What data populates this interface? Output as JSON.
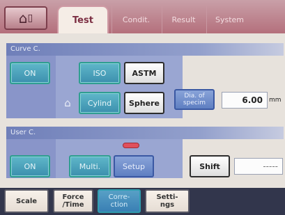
{
  "tabs": [
    {
      "label": "Test",
      "active": true
    },
    {
      "label": "Condit."
    },
    {
      "label": "Result"
    },
    {
      "label": "System"
    }
  ],
  "icons": {
    "home": "home-icon",
    "lock": "lock-icon"
  },
  "curve_section": {
    "title": "Curve C.",
    "on_label": "ON",
    "iso_label": "ISO",
    "astm_label": "ASTM",
    "cylind_label": "Cylind",
    "sphere_label": "Sphere",
    "dia_label": "Dia. of\nspecim",
    "dia_value": "6.00",
    "dia_unit": "mm"
  },
  "user_section": {
    "title": "User C.",
    "on_label": "ON",
    "multi_label": "Multi.",
    "setup_label": "Setup",
    "shift_label": "Shift",
    "shift_value": "-----"
  },
  "bottom": {
    "scale": "Scale",
    "force_time": "Force\n/Time",
    "correction": "Corre-\nction",
    "settings": "Setti-\nngs"
  },
  "colors": {
    "accent": "#6f7fb9",
    "tab_bar": "#b4707c",
    "indicator": "#e0505c"
  }
}
